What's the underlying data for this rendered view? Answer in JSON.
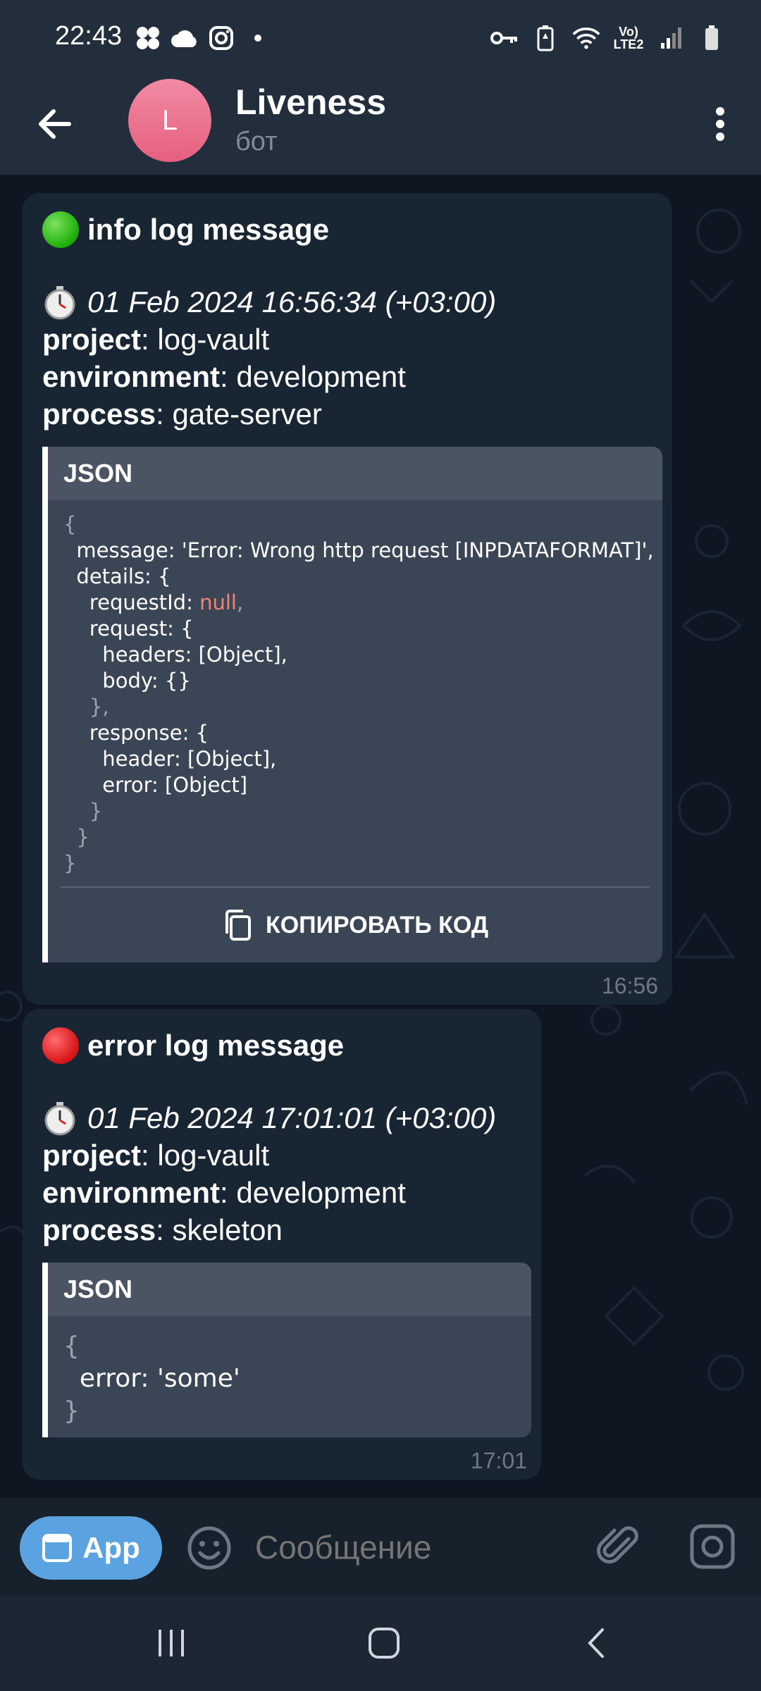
{
  "status_bar": {
    "time": "22:43",
    "network": "Vo) LTE2",
    "icons": [
      "multi-dot-icon",
      "cloud-icon",
      "instagram-icon",
      "dot-icon",
      "key-icon",
      "battery-saver-icon",
      "wifi-icon",
      "signal-icon",
      "battery-icon"
    ]
  },
  "header": {
    "avatar_letter": "L",
    "title": "Liveness",
    "subtitle": "бот",
    "accent": "#e8668a"
  },
  "messages": [
    {
      "level_label": "info log message",
      "level_color": "#23b10f",
      "datetime": "01 Feb 2024 16:56:34 (+03:00)",
      "project_key": "project",
      "project": "log-vault",
      "environment_key": "environment",
      "environment": "development",
      "process_key": "process",
      "process": "gate-server",
      "code_lang": "JSON",
      "code_lines": {
        "l1": "{",
        "l2": "  message: 'Error: Wrong http request [INPDATAFORMAT]',",
        "l3": "  details: {",
        "l4": "    requestId: ",
        "l4_null": "null",
        "l4_end": ",",
        "l5": "    request: {",
        "l6": "      headers: [Object],",
        "l7": "      body: {}",
        "l8": "    },",
        "l9": "    response: {",
        "l10": "      header: [Object],",
        "l11": "      error: [Object]",
        "l12": "    }",
        "l13": "  }",
        "l14": "}"
      },
      "copy_label": "КОПИРОВАТЬ КОД",
      "time": "16:56"
    },
    {
      "level_label": "error log message",
      "level_color": "#d9191c",
      "datetime": "01 Feb 2024 17:01:01 (+03:00)",
      "project_key": "project",
      "project": "log-vault",
      "environment_key": "environment",
      "environment": "development",
      "process_key": "process",
      "process": "skeleton",
      "code_lang": "JSON",
      "code_lines": {
        "l1": "{",
        "l2": "  error: 'some'",
        "l3": "}"
      },
      "time": "17:01"
    }
  ],
  "input_bar": {
    "app_label": "App",
    "placeholder": "Сообщение"
  }
}
